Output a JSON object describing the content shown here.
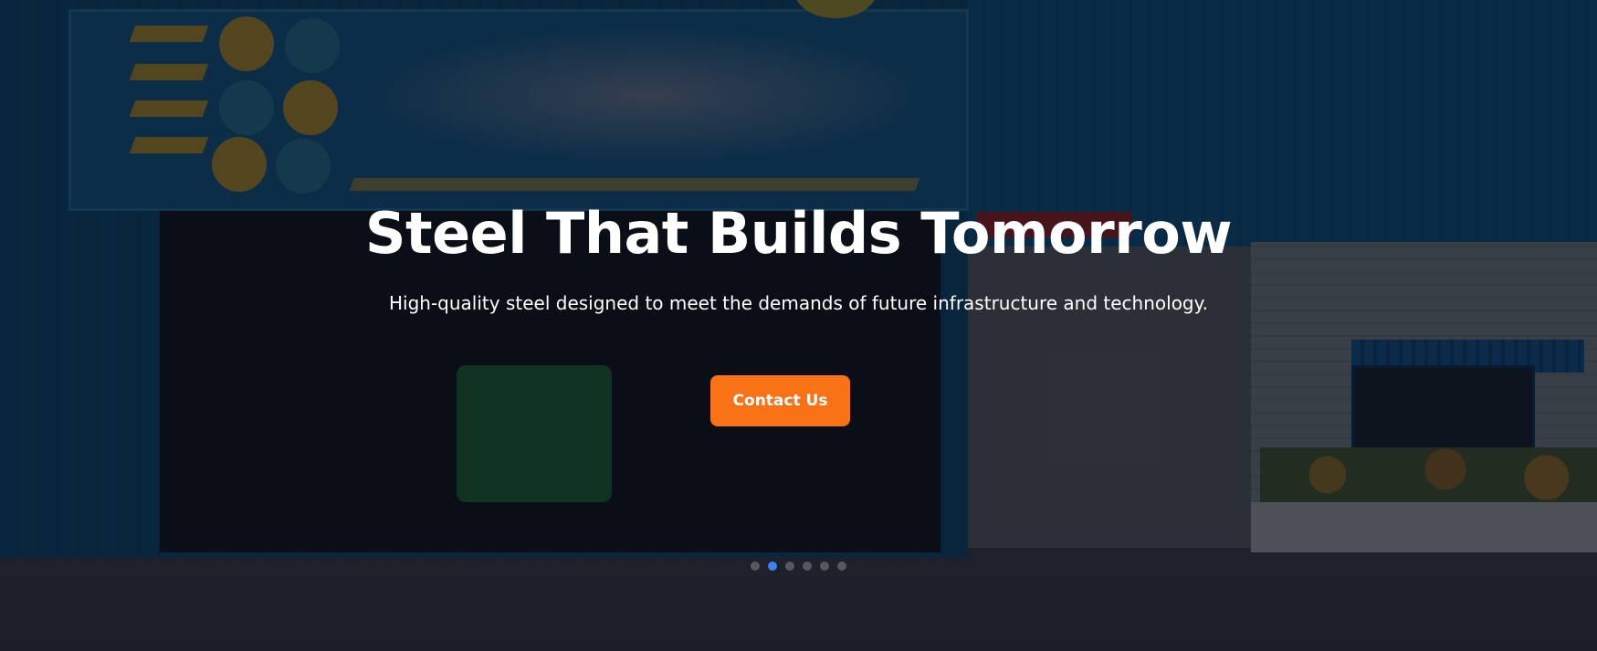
{
  "hero": {
    "title": "Steel That Builds Tomorrow",
    "subtitle": "High-quality steel designed to meet the demands of future infrastructure and technology.",
    "cta_label": "Contact Us"
  },
  "carousel": {
    "total_slides": 6,
    "active_index": 1
  },
  "colors": {
    "accent": "#f97316",
    "active_dot": "#3b82f6",
    "text": "#ffffff"
  }
}
